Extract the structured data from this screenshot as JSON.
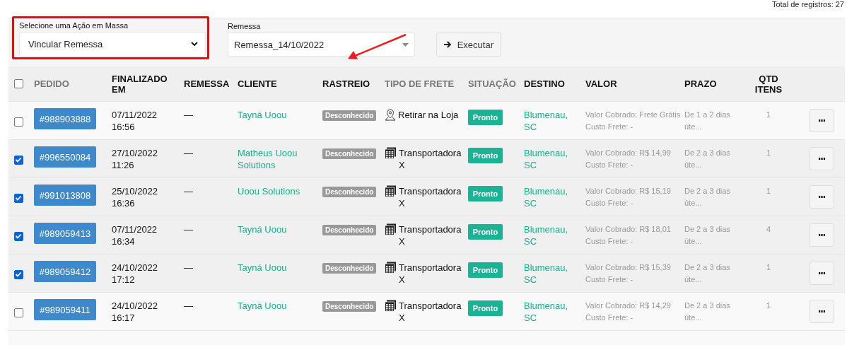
{
  "total_records": "Total de registros: 27",
  "bulk_action": {
    "label": "Selecione uma Ação em Massa",
    "value": "Vincular Remessa"
  },
  "shipment_filter": {
    "label": "Remessa",
    "value": "Remessa_14/10/2022"
  },
  "execute_button": "Executar",
  "table": {
    "select_all": {
      "checked": false
    },
    "columns": [
      {
        "label": "PEDIDO",
        "muted": true
      },
      {
        "label": "FINALIZADO EM",
        "muted": false
      },
      {
        "label": "REMESSA",
        "muted": false
      },
      {
        "label": "CLIENTE",
        "muted": false
      },
      {
        "label": "RASTREIO",
        "muted": false
      },
      {
        "label": "TIPO DE FRETE",
        "muted": true
      },
      {
        "label": "SITUAÇÃO",
        "muted": true
      },
      {
        "label": "DESTINO",
        "muted": false
      },
      {
        "label": "VALOR",
        "muted": false
      },
      {
        "label": "PRAZO",
        "muted": false
      },
      {
        "label": "QTD ITENS",
        "muted": false
      }
    ],
    "rows": [
      {
        "checked": false,
        "order": "#988903888",
        "finished": "07/11/2022 16:56",
        "shipment": "—",
        "client": "Tayná Uoou",
        "tracking": "Desconhecido",
        "shipping": {
          "kind": "pickup",
          "label": "Retirar na Loja"
        },
        "status": "Pronto",
        "destination": "Blumenau, SC",
        "charged": "Valor Cobrado: Frete Grátis",
        "cost": "Custo Frete: -",
        "deadline": "De 1 a 2 dias úte...",
        "items": "1"
      },
      {
        "checked": true,
        "order": "#996550084",
        "finished": "27/10/2022 11:26",
        "shipment": "—",
        "client": "Matheus Uoou Solutions",
        "tracking": "Desconhecido",
        "shipping": {
          "kind": "carrier",
          "label": "Transportadora X"
        },
        "status": "Pronto",
        "destination": "Blumenau, SC",
        "charged": "Valor Cobrado: R$ 14,99",
        "cost": "Custo Frete: -",
        "deadline": "De 2 a 3 dias úte...",
        "items": "1"
      },
      {
        "checked": true,
        "order": "#991013808",
        "finished": "25/10/2022 16:36",
        "shipment": "—",
        "client": "Uoou Solutions",
        "tracking": "Desconhecido",
        "shipping": {
          "kind": "carrier",
          "label": "Transportadora X"
        },
        "status": "Pronto",
        "destination": "Blumenau, SC",
        "charged": "Valor Cobrado: R$ 15,19",
        "cost": "Custo Frete: -",
        "deadline": "De 2 a 3 dias úte...",
        "items": "1"
      },
      {
        "checked": true,
        "order": "#989059413",
        "finished": "07/11/2022 16:34",
        "shipment": "—",
        "client": "Tayná Uoou",
        "tracking": "Desconhecido",
        "shipping": {
          "kind": "carrier",
          "label": "Transportadora X"
        },
        "status": "Pronto",
        "destination": "Blumenau, SC",
        "charged": "Valor Cobrado: R$ 18,01",
        "cost": "Custo Frete: -",
        "deadline": "De 2 a 3 dias úte...",
        "items": "4"
      },
      {
        "checked": true,
        "order": "#989059412",
        "finished": "24/10/2022 17:12",
        "shipment": "—",
        "client": "Tayná Uoou",
        "tracking": "Desconhecido",
        "shipping": {
          "kind": "carrier",
          "label": "Transportadora X"
        },
        "status": "Pronto",
        "destination": "Blumenau, SC",
        "charged": "Valor Cobrado: R$ 15,39",
        "cost": "Custo Frete: -",
        "deadline": "De 2 a 3 dias úte...",
        "items": "1"
      },
      {
        "checked": false,
        "order": "#989059411",
        "finished": "24/10/2022 16:17",
        "shipment": "—",
        "client": "Tayná Uoou",
        "tracking": "Desconhecido",
        "shipping": {
          "kind": "carrier",
          "label": "Transportadora X"
        },
        "status": "Pronto",
        "destination": "Blumenau, SC",
        "charged": "Valor Cobrado: R$ 14,29",
        "cost": "Custo Frete: -",
        "deadline": "De 2 a 3 dias úte...",
        "items": "1"
      }
    ]
  }
}
